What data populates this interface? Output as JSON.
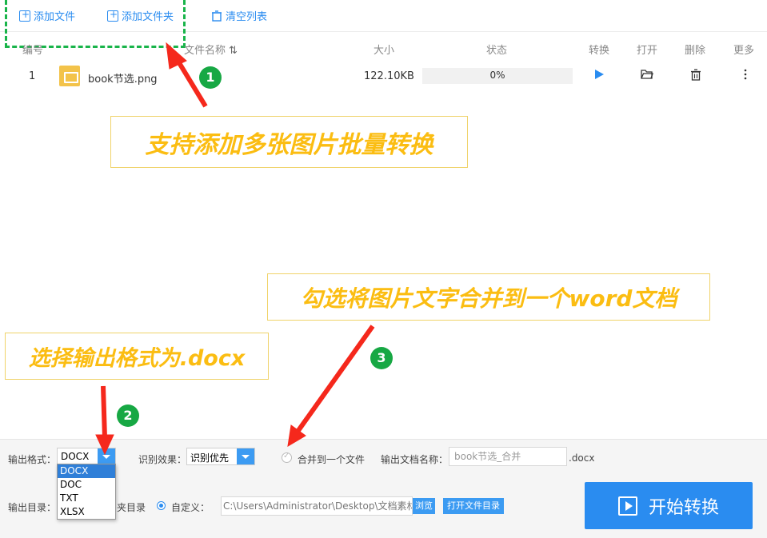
{
  "toolbar": {
    "add_file": "添加文件",
    "add_folder": "添加文件夹",
    "clear_list": "清空列表"
  },
  "table": {
    "headers": {
      "index": "编号",
      "name": "文件名称",
      "size": "大小",
      "status": "状态",
      "convert": "转换",
      "open": "打开",
      "delete": "删除",
      "more": "更多"
    },
    "rows": [
      {
        "index": "1",
        "name": "book节选.png",
        "size": "122.10KB",
        "progress": "0%"
      }
    ]
  },
  "callouts": {
    "batch": "支持添加多张图片批量转换",
    "merge": "勾选将图片文字合并到一个word文档",
    "format": "选择输出格式为.docx"
  },
  "badges": {
    "one": "1",
    "two": "2",
    "three": "3"
  },
  "bottom": {
    "format_label": "输出格式：",
    "format_value": "DOCX",
    "format_options": [
      "DOCX",
      "DOC",
      "TXT",
      "XLSX"
    ],
    "recognize_label": "识别效果：",
    "recognize_value": "识别优先",
    "merge_label": "合并到一个文件",
    "docname_label": "输出文档名称：",
    "docname_value": "book节选_合并",
    "docname_ext": ".docx",
    "dir_label": "输出目录：",
    "dir_partial": "夹目录",
    "custom_label": "自定义：",
    "path_value": "C:\\Users\\Administrator\\Desktop\\文档素材",
    "browse": "浏览",
    "open_dir": "打开文件目录",
    "start": "开始转换"
  },
  "colors": {
    "accent": "#2a8cf0",
    "callout_text": "#fbbd12",
    "badge": "#17a844",
    "arrow": "#f5281c",
    "dash": "#19b44a"
  }
}
